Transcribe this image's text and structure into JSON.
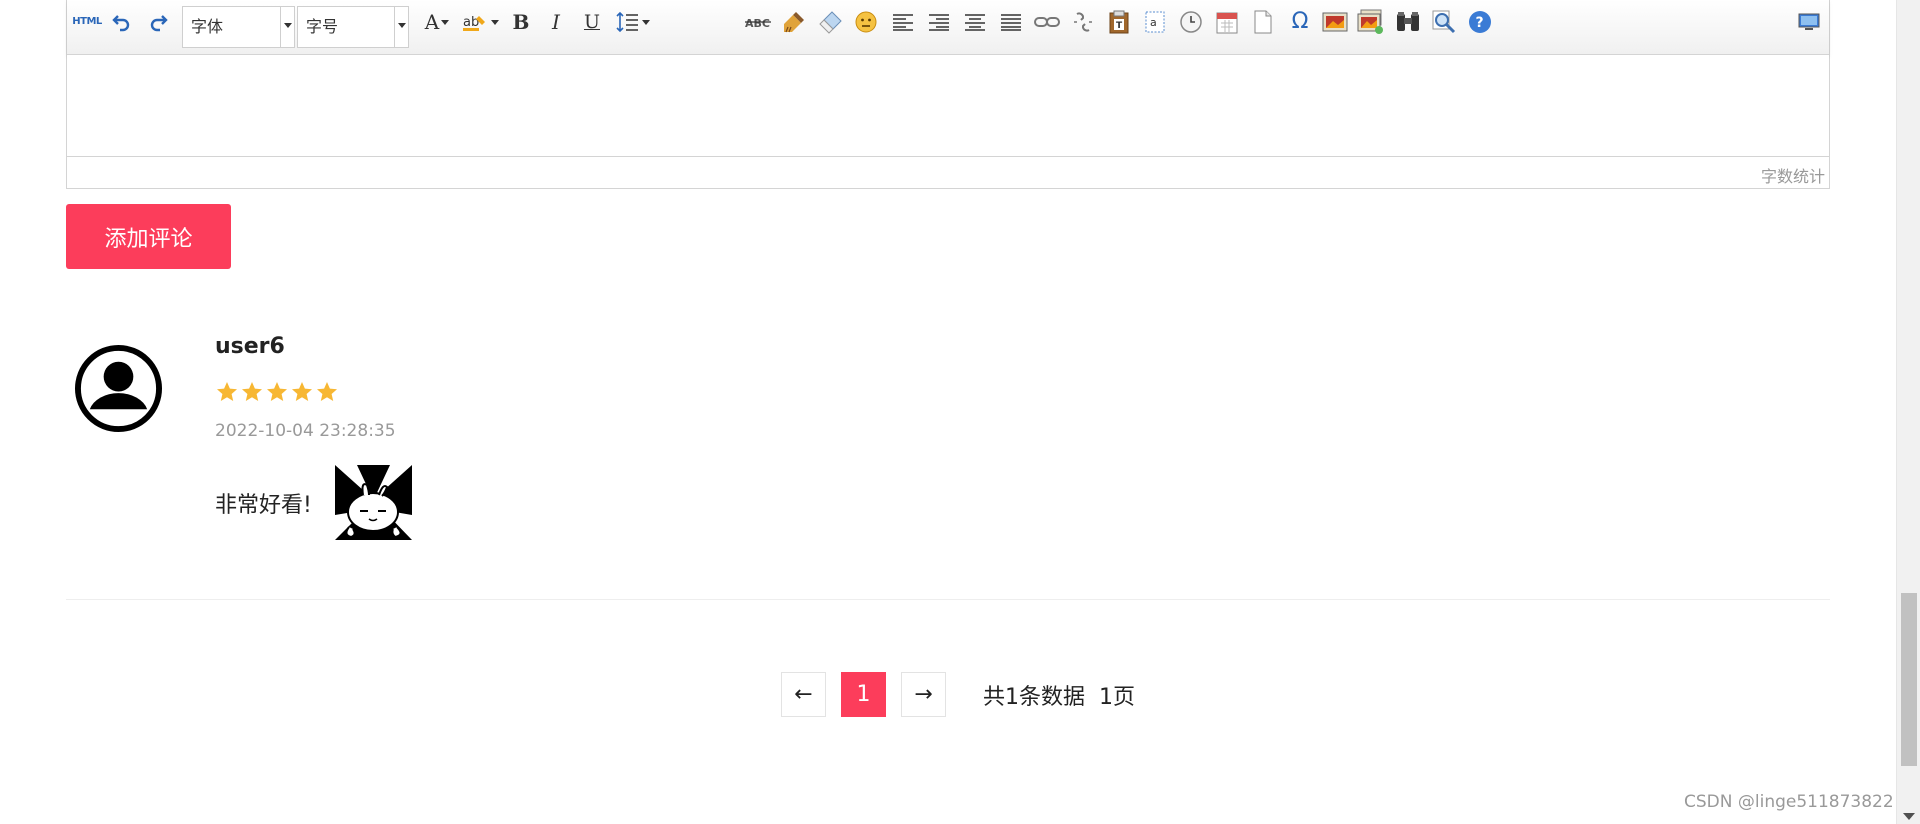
{
  "editor": {
    "toolbar": {
      "html_label": "HTML",
      "font_family": "字体",
      "font_size": "字号",
      "font_color_label": "A",
      "bold_label": "B",
      "italic_label": "I",
      "underline_label": "U",
      "special_char_label": "Ω"
    },
    "word_count_label": "字数统计"
  },
  "add_comment_label": "添加评论",
  "comment": {
    "user": "user6",
    "rating": 5,
    "rating_max": 5,
    "time": "2022-10-04 23:28:35",
    "text": "非常好看!",
    "star_color": "#f7b733"
  },
  "pagination": {
    "prev": "←",
    "current": "1",
    "next": "→",
    "info": "共1条数据  1页"
  },
  "watermark": "CSDN @linge511873822",
  "colors": {
    "accent": "#fc3d5b",
    "text": "#222222",
    "muted": "#999999"
  }
}
